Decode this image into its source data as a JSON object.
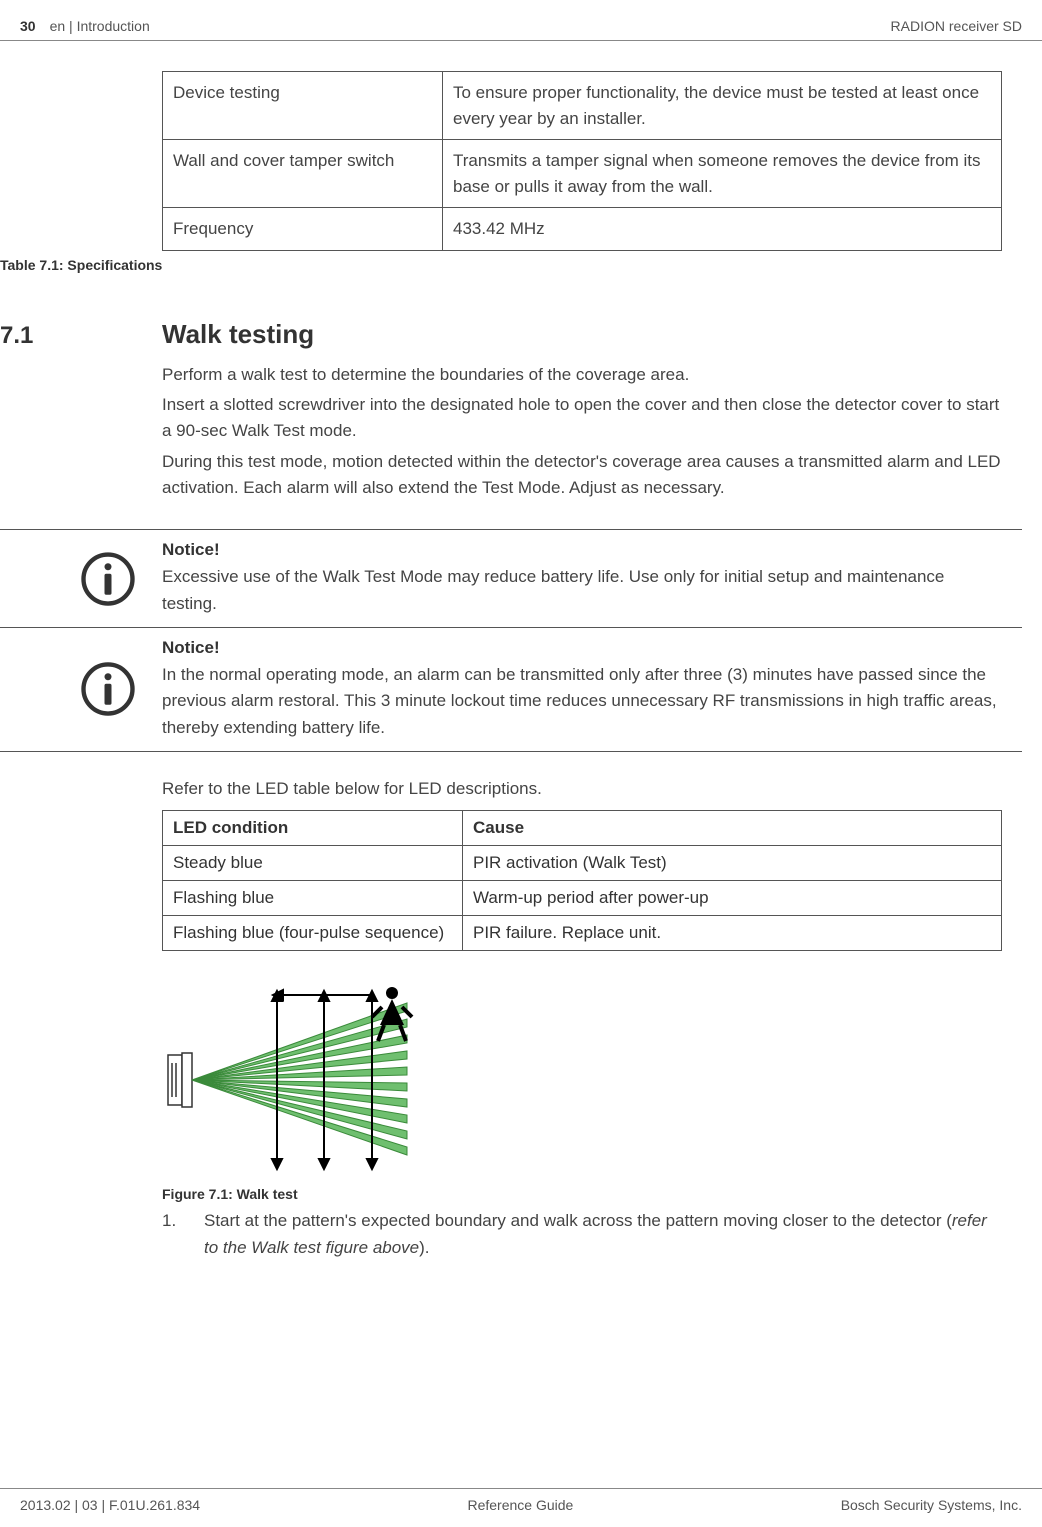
{
  "header": {
    "page_number": "30",
    "breadcrumb": "en | Introduction",
    "product": "RADION receiver SD"
  },
  "spec_table": {
    "rows": [
      {
        "label": "Device testing",
        "value": "To ensure proper functionality, the device must be tested at least once every year by an installer."
      },
      {
        "label": "Wall and cover tamper switch",
        "value": "Transmits a tamper signal when someone removes the device from its base or pulls it away from the wall."
      },
      {
        "label": "Frequency",
        "value": "433.42 MHz"
      }
    ],
    "caption": "Table 7.1: Specifications"
  },
  "section": {
    "number": "7.1",
    "title": "Walk testing",
    "para1": "Perform a walk test to determine the boundaries of the coverage area.",
    "para2": "Insert a slotted screwdriver into the designated hole to open the cover and then close the detector cover to start a 90-sec Walk Test mode.",
    "para3": "During this test mode, motion detected within the detector's coverage area causes a transmitted alarm and LED activation. Each alarm will also extend the Test Mode. Adjust as necessary."
  },
  "notices": [
    {
      "title": "Notice!",
      "body": "Excessive use of the Walk Test Mode may reduce battery life. Use only for initial setup and maintenance testing."
    },
    {
      "title": "Notice!",
      "body": "In the normal operating mode, an alarm can be transmitted only after three (3) minutes have passed since the previous alarm restoral. This 3 minute lockout time reduces unnecessary RF transmissions in high traffic areas, thereby extending battery life."
    }
  ],
  "led": {
    "intro": "Refer to the LED table below for LED descriptions.",
    "headers": {
      "col1": "LED condition",
      "col2": "Cause"
    },
    "rows": [
      {
        "condition": "Steady blue",
        "cause": "PIR activation (Walk Test)"
      },
      {
        "condition": "Flashing blue",
        "cause": "Warm-up period after power-up"
      },
      {
        "condition": "Flashing blue (four-pulse sequence)",
        "cause": "PIR failure. Replace unit."
      }
    ]
  },
  "figure": {
    "caption": "Figure 7.1: Walk test"
  },
  "steps": {
    "item1_num": "1.",
    "item1_text_a": "Start at the pattern's expected boundary and walk across the pattern moving closer to the detector (",
    "item1_text_italic": "refer to the Walk test figure above",
    "item1_text_b": ")."
  },
  "footer": {
    "left": "2013.02 | 03 | F.01U.261.834",
    "center": "Reference Guide",
    "right": "Bosch Security Systems, Inc."
  }
}
